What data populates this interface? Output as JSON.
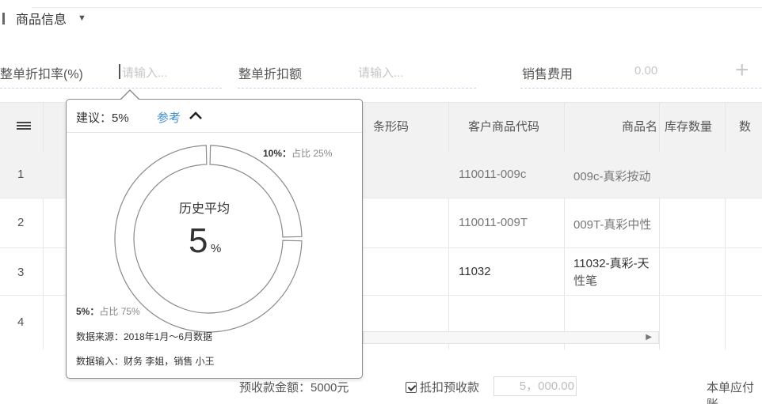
{
  "section": {
    "title": "商品信息",
    "caret": "▼"
  },
  "form": {
    "discount_rate_label": "整单折扣率(%)",
    "discount_rate_placeholder": "请输入...",
    "discount_amount_label": "整单折扣额",
    "discount_amount_placeholder": "请输入...",
    "sales_fee_label": "销售费用",
    "sales_fee_value": "0.00",
    "add_icon": "plus-icon"
  },
  "table": {
    "menu_icon": "list-icon",
    "columns": [
      "条形码",
      "客户商品代码",
      "商品名",
      "库存数量",
      "数量"
    ],
    "rows": [
      {
        "index": "1",
        "customer_code": "110011-009c",
        "name": "009c-真彩按动"
      },
      {
        "index": "2",
        "customer_code": "110011-009T",
        "name": "009T-真彩中性"
      },
      {
        "index": "3",
        "customer_code": "11032",
        "name_line1": "11032-真彩-天",
        "name_line2": "性笔"
      },
      {
        "index": "4"
      }
    ]
  },
  "footer": {
    "prepay_amount": "预收款金额：5000元",
    "deduct_label": "抵扣预收款",
    "deduct_checked": true,
    "deduct_value": "5，000.00",
    "payable_label": "本单应付账"
  },
  "popover": {
    "suggestion": "建议：5%",
    "reference_link": "参考",
    "chevron_icon": "chevron-up-icon",
    "center_title": "历史平均",
    "center_value": "5",
    "center_unit": "%",
    "slice_10_value": "10%：",
    "slice_10_share": "占比 25%",
    "slice_5_value": "5%：",
    "slice_5_share": "占比 75%",
    "data_source": "数据来源：2018年1月～6月数据",
    "data_input": "数据输入：财务 李姐，销售 小王"
  },
  "chart_data": {
    "type": "pie",
    "categories": [
      "10%",
      "5%"
    ],
    "values": [
      25,
      75
    ],
    "labels": [
      "10%：占比 25%",
      "5%：占比 75%"
    ],
    "center_label": "历史平均",
    "center_value": "5%"
  },
  "colors": {
    "link": "#3d8fd8",
    "header_bg": "#f2f2f2",
    "popover_border": "#8d8d8d"
  }
}
